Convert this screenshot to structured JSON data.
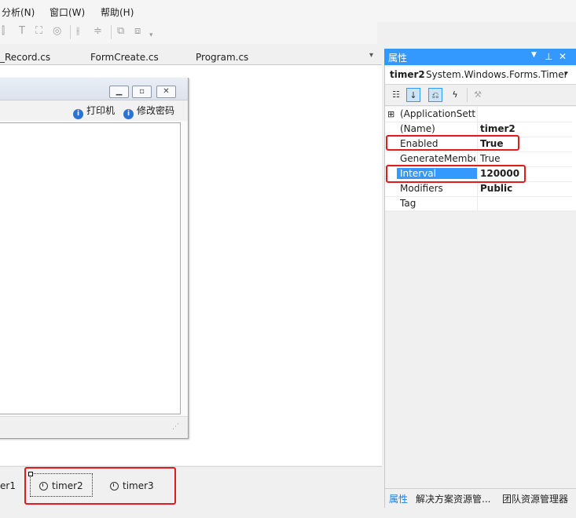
{
  "menu": {
    "analyze": "分析(N)",
    "window": "窗口(W)",
    "help": "帮助(H)"
  },
  "toolbar": {
    "icons": [
      "align-icon",
      "text-icon",
      "size-icon",
      "center-icon",
      "space-h-icon",
      "space-v-icon",
      "order-icon",
      "order-back-icon",
      "overflow-icon"
    ]
  },
  "tabs": {
    "tab1": "_Record.cs",
    "tab2": "FormCreate.cs",
    "tab3": "Program.cs"
  },
  "form": {
    "menu_print": "打印机",
    "menu_password": "修改密码"
  },
  "tray": {
    "item1": "er1",
    "item2": "timer2",
    "item3": "timer3"
  },
  "properties": {
    "title": "属性",
    "object_name": "timer2",
    "object_type": "System.Windows.Forms.Timer",
    "rows": [
      {
        "name": "(ApplicationSettin",
        "value": ""
      },
      {
        "name": "(Name)",
        "value": "timer2"
      },
      {
        "name": "Enabled",
        "value": "True"
      },
      {
        "name": "GenerateMembe",
        "value": "True"
      },
      {
        "name": "Interval",
        "value": "120000"
      },
      {
        "name": "Modifiers",
        "value": "Public"
      },
      {
        "name": "Tag",
        "value": ""
      }
    ],
    "bottom_tabs": [
      "属性",
      "解决方案资源管...",
      "团队资源管理器"
    ]
  },
  "colors": {
    "accent": "#3399ff",
    "highlight": "#e01c1c"
  }
}
